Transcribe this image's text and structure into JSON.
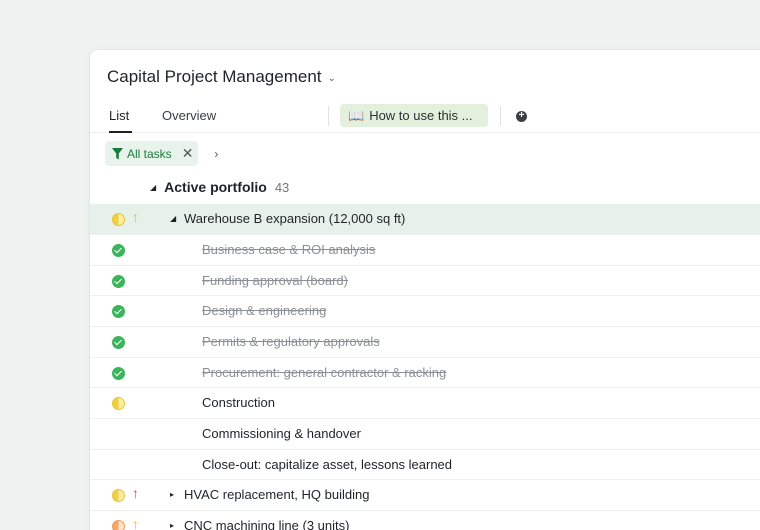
{
  "app": {
    "title": "Capital Project Management",
    "title_chevron": "⌄"
  },
  "tabs": {
    "list": "List",
    "overview": "Overview",
    "guide_icon": "📖",
    "guide": "How to use this ...",
    "add": "+"
  },
  "filter": {
    "label": "All tasks",
    "close": "✕",
    "next": "›"
  },
  "section": {
    "title": "Active portfolio",
    "count": "43"
  },
  "rows": [
    {
      "text": "Warehouse B expansion (12,000 sq ft)",
      "status": "half",
      "priority": "↑",
      "priority_color": "#e8b92a"
    },
    {
      "text": "Business case & ROI analysis",
      "status": "done"
    },
    {
      "text": "Funding approval (board)",
      "status": "done"
    },
    {
      "text": "Design & engineering",
      "status": "done"
    },
    {
      "text": "Permits & regulatory approvals",
      "status": "done"
    },
    {
      "text": "Procurement: general contractor & racking",
      "status": "done"
    },
    {
      "text": "Construction",
      "status": "half"
    },
    {
      "text": "Commissioning & handover",
      "status": "none"
    },
    {
      "text": "Close-out: capitalize asset, lessons learned",
      "status": "none"
    },
    {
      "text": "HVAC replacement, HQ building",
      "status": "half",
      "priority": "↑",
      "priority_color": "#e0435b"
    },
    {
      "text": "CNC machining line (3 units)",
      "status": "half-orange",
      "priority": "↑",
      "priority_color": "#e8b92a"
    }
  ],
  "colors": {
    "accent_green": "#1b7b3c",
    "done_green": "#3bb55b",
    "row_highlight": "#e6f1ea",
    "background": "#eef3f1"
  }
}
